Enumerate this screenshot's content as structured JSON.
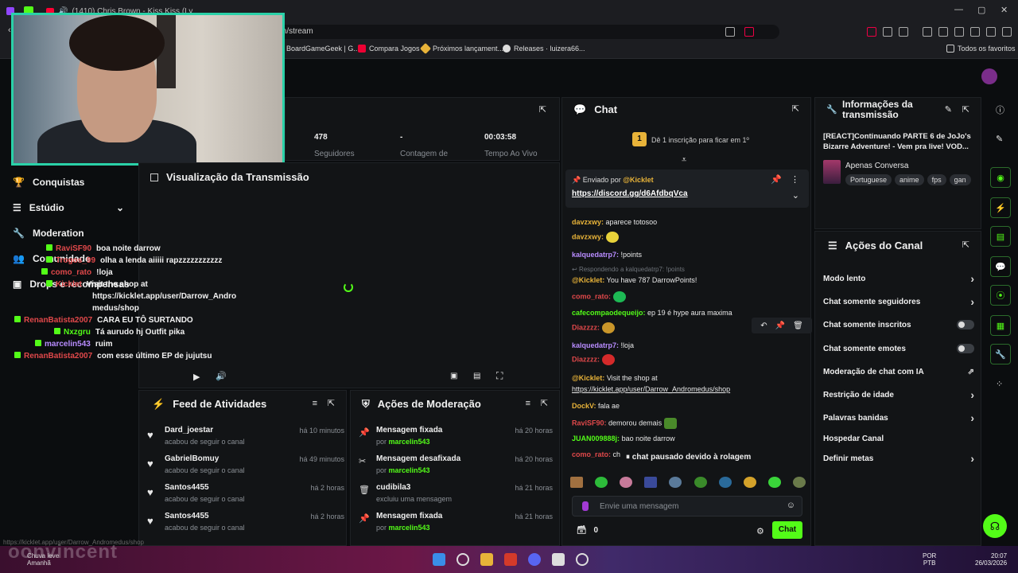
{
  "browser": {
    "tab_title": "(1410) Chris Brown - Kiss Kiss (Ly",
    "url_visible": "m/stream",
    "bookmarks": [
      "BoardGameGeek | G...",
      "Compara Jogos",
      "Próximos lançament...",
      "Releases · luizera66..."
    ],
    "all_bookmarks": "Todos os favoritos"
  },
  "nav": {
    "items": [
      "Conquistas",
      "Estúdio",
      "Moderation",
      "Comunidade",
      "Drops e recompensas"
    ]
  },
  "stats": {
    "followers_value": "478",
    "followers_label": "Seguidores",
    "count_value": "-",
    "count_label": "Contagem de",
    "live_value": "00:03:58",
    "live_label": "Tempo Ao Vivo"
  },
  "preview": {
    "title": "Visualização da Transmissão"
  },
  "overlay_chat": [
    {
      "user": "RaviSF90",
      "color": "#e0484a",
      "msg": "boa noite darrow"
    },
    {
      "user": "Trogos_99",
      "color": "#e0484a",
      "msg": "olha a lenda aiiiii rapzzzzzzzzzzz"
    },
    {
      "user": "como_rato",
      "color": "#e0484a",
      "msg": "!loja"
    },
    {
      "user": "Kicklet",
      "color": "#e0484a",
      "msg": "Visit the shop at"
    },
    {
      "user": "",
      "color": "#e0484a",
      "msg": "https://kicklet.app/user/Darrow_Andro"
    },
    {
      "user": "",
      "color": "#e0484a",
      "msg": "medus/shop"
    },
    {
      "user": "RenanBatista2007",
      "color": "#e0484a",
      "msg": "CARA EU TÔ SURTANDO"
    },
    {
      "user": "Nxzgru",
      "color": "#53fc18",
      "msg": "Tá aurudo hj Outfit pika"
    },
    {
      "user": "marcelin543",
      "color": "#b88cff",
      "msg": "ruim"
    },
    {
      "user": "RenanBatista2007",
      "color": "#e0484a",
      "msg": "com esse último EP de jujutsu"
    }
  ],
  "feed": {
    "title": "Feed de Atividades",
    "rows": [
      {
        "name": "Dard_joestar",
        "sub": "acabou de seguir o canal",
        "time": "há 10 minutos"
      },
      {
        "name": "GabrielBomuy",
        "sub": "acabou de seguir o canal",
        "time": "há 49 minutos"
      },
      {
        "name": "Santos4455",
        "sub": "acabou de seguir o canal",
        "time": "há 2 horas"
      },
      {
        "name": "Santos4455",
        "sub": "acabou de seguir o canal",
        "time": "há 2 horas"
      }
    ]
  },
  "mod": {
    "title": "Ações de Moderação",
    "rows": [
      {
        "icon": "pin-icon",
        "name": "Mensagem fixada",
        "by": "por",
        "user": "marcelin543",
        "time": "há 20 horas"
      },
      {
        "icon": "unpin-icon",
        "name": "Mensagem desafixada",
        "by": "por",
        "user": "marcelin543",
        "time": "há 20 horas"
      },
      {
        "icon": "trash-icon",
        "name": "cudibila3",
        "by": "excluiu uma mensagem",
        "user": "",
        "time": "há 21 horas"
      },
      {
        "icon": "pin-icon",
        "name": "Mensagem fixada",
        "by": "por",
        "user": "marcelin543",
        "time": "há 21 horas"
      }
    ]
  },
  "chat": {
    "title": "Chat",
    "sub_banner_rank": "1",
    "sub_banner": "Dê 1 inscrição para ficar em 1º",
    "pinned_prefix": "Enviado por",
    "pinned_user": "@Kicklet",
    "pinned_link": "https://discord.gg/d6AfdbqVca",
    "reply_note": "Respondendo a kalquedatrp7: !points",
    "paused": "chat pausado devido à rolagem",
    "input_placeholder": "Envie uma mensagem",
    "points": "0",
    "send": "Chat",
    "messages": [
      {
        "user": "davzxwy:",
        "color": "#e8b339",
        "text": "aparece totosoo"
      },
      {
        "user": "davzxwy:",
        "color": "#e8b339",
        "text": ""
      },
      {
        "user": "kalquedatrp7:",
        "color": "#b88cff",
        "text": "!points"
      },
      {
        "user": "@Kicklet:",
        "color": "#e8b339",
        "text": "You have 787 DarrowPoints!"
      },
      {
        "user": "como_rato:",
        "color": "#e0484a",
        "text": ""
      },
      {
        "user": "cafecompaodequeijo:",
        "color": "#53fc18",
        "text": "ep 19 é hype aura maxima"
      },
      {
        "user": "Diazzzz:",
        "color": "#e0484a",
        "text": ""
      },
      {
        "user": "kalquedatrp7:",
        "color": "#b88cff",
        "text": "!loja"
      },
      {
        "user": "Diazzzz:",
        "color": "#e0484a",
        "text": ""
      },
      {
        "user": "@Kicklet:",
        "color": "#e8b339",
        "text": "Visit the shop at"
      },
      {
        "user": "",
        "color": "#e8e8e8",
        "text": "https://kicklet.app/user/Darrow_Andromedus/shop"
      },
      {
        "user": "DockV:",
        "color": "#e8b339",
        "text": "fala ae"
      },
      {
        "user": "RaviSF90:",
        "color": "#e0484a",
        "text": "demorou demais"
      },
      {
        "user": "JUAN009888j:",
        "color": "#53fc18",
        "text": "bao noite darrow"
      },
      {
        "user": "como_rato:",
        "color": "#e0484a",
        "text": "ch"
      }
    ]
  },
  "info": {
    "title_line1": "Informações da",
    "title_line2": "transmissão",
    "stream_title": "[REACT]Continuando PARTE 6 de JoJo's Bizarre Adventure! - Vem pra live! VOD...",
    "category": "Apenas Conversa",
    "tags": [
      "Portuguese",
      "anime",
      "fps",
      "gan"
    ]
  },
  "channel_actions": {
    "title": "Ações do Canal",
    "items": [
      {
        "label": "Modo lento",
        "kind": "chevron"
      },
      {
        "label": "Chat somente seguidores",
        "kind": "chevron"
      },
      {
        "label": "Chat somente inscritos",
        "kind": "toggle"
      },
      {
        "label": "Chat somente emotes",
        "kind": "toggle"
      },
      {
        "label": "Moderação de chat com IA",
        "kind": "external"
      },
      {
        "label": "Restrição de idade",
        "kind": "chevron"
      },
      {
        "label": "Palavras banidas",
        "kind": "chevron"
      },
      {
        "label": "Hospedar Canal",
        "kind": "none"
      },
      {
        "label": "Definir metas",
        "kind": "chevron"
      }
    ]
  },
  "taskbar": {
    "weather": "Chuva leve",
    "weather_sub": "Amanhã",
    "lang1": "POR",
    "lang2": "PTB",
    "time": "20:07",
    "date": "26/03/2026",
    "status_url": "https://kicklet.app/user/Darrow_Andromedus/shop",
    "wallpaper_text": "oonvincent"
  }
}
